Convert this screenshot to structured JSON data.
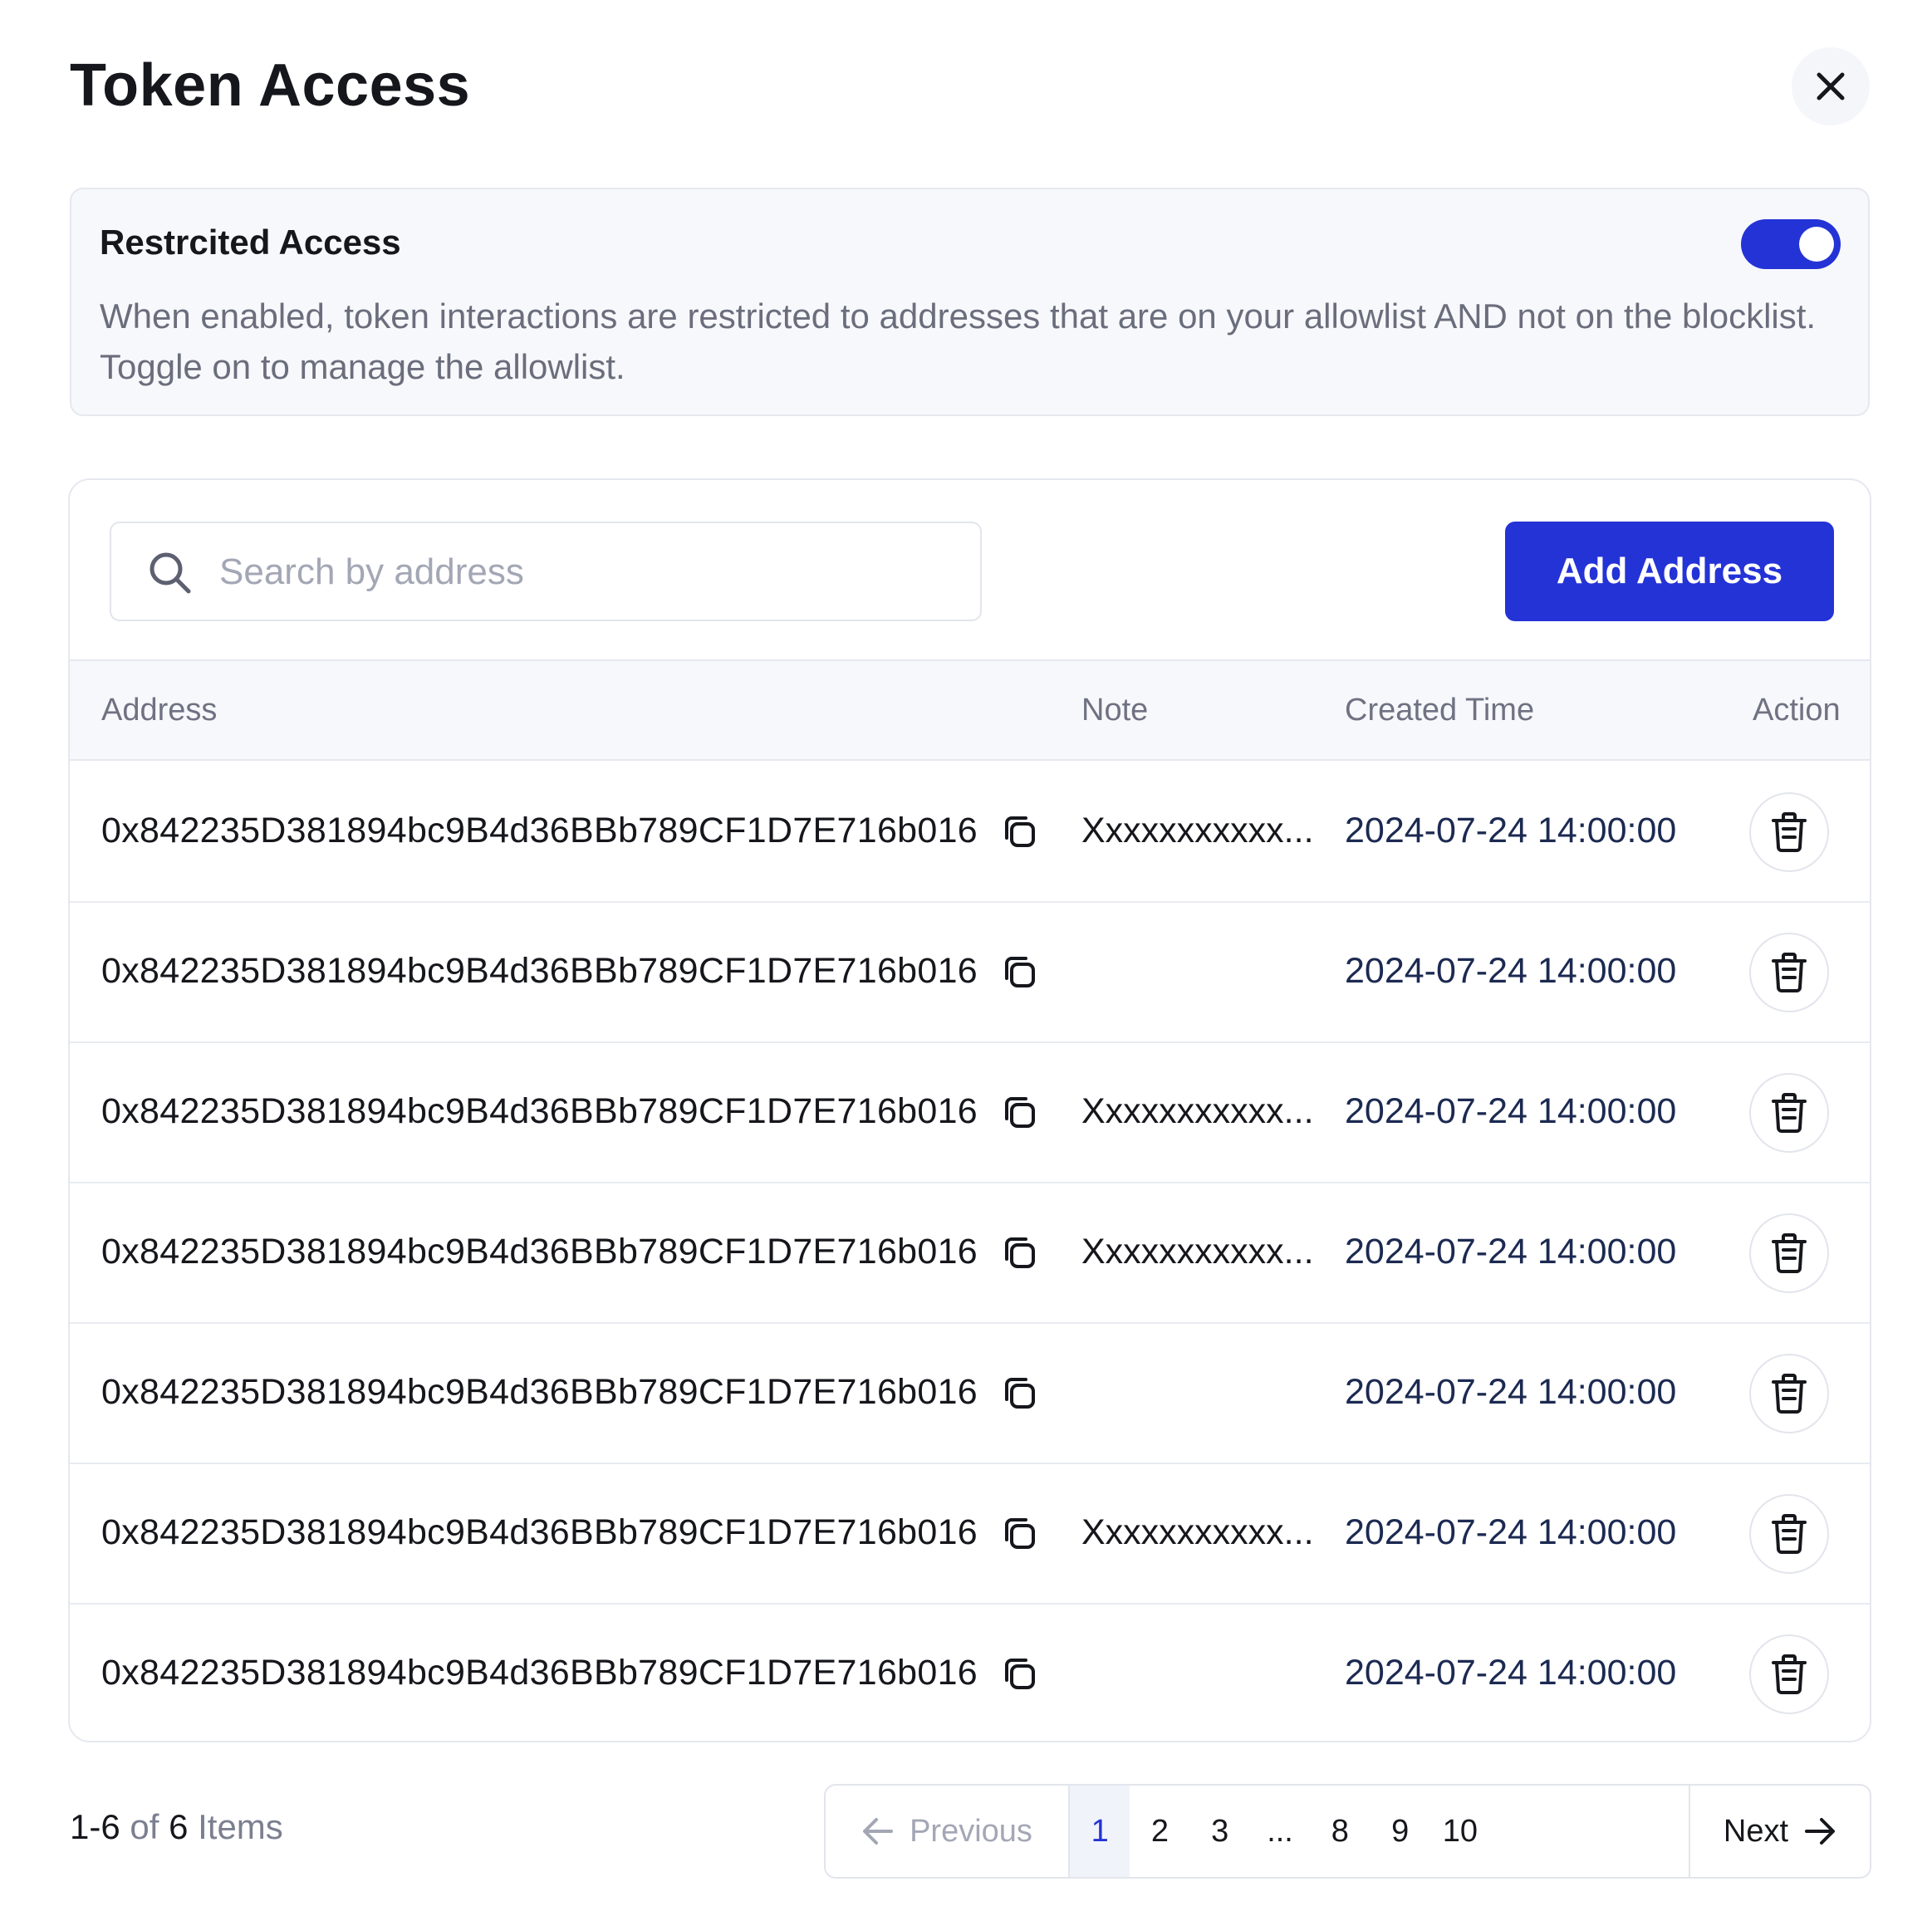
{
  "header": {
    "title": "Token Access"
  },
  "notice": {
    "title": "Restrcited Access",
    "description": "When enabled, token interactions are restricted to addresses that are on your allowlist AND not on the blocklist. Toggle on to manage the allowlist.",
    "toggle_on": true,
    "accent_color": "#2433d6"
  },
  "toolbar": {
    "search_placeholder": "Search by address",
    "search_value": "",
    "add_label": "Add Address"
  },
  "table": {
    "columns": [
      "Address",
      "Note",
      "Created Time",
      "Action"
    ],
    "rows": [
      {
        "address": "0x842235D381894bc9B4d36BBb789CF1D7E716b016",
        "note": "Xxxxxxxxxxx...",
        "created": "2024-07-24 14:00:00"
      },
      {
        "address": "0x842235D381894bc9B4d36BBb789CF1D7E716b016",
        "note": "",
        "created": "2024-07-24 14:00:00"
      },
      {
        "address": "0x842235D381894bc9B4d36BBb789CF1D7E716b016",
        "note": "Xxxxxxxxxxx...",
        "created": "2024-07-24 14:00:00"
      },
      {
        "address": "0x842235D381894bc9B4d36BBb789CF1D7E716b016",
        "note": "Xxxxxxxxxxx...",
        "created": "2024-07-24 14:00:00"
      },
      {
        "address": "0x842235D381894bc9B4d36BBb789CF1D7E716b016",
        "note": "",
        "created": "2024-07-24 14:00:00"
      },
      {
        "address": "0x842235D381894bc9B4d36BBb789CF1D7E716b016",
        "note": "Xxxxxxxxxxx...",
        "created": "2024-07-24 14:00:00"
      },
      {
        "address": "0x842235D381894bc9B4d36BBb789CF1D7E716b016",
        "note": "",
        "created": "2024-07-24 14:00:00"
      }
    ]
  },
  "footer": {
    "range": "1-6",
    "of": "of",
    "total": "6",
    "items_word": "Items"
  },
  "pagination": {
    "prev_label": "Previous",
    "next_label": "Next",
    "pages": [
      "1",
      "2",
      "3",
      "...",
      "8",
      "9",
      "10"
    ],
    "current": "1"
  }
}
